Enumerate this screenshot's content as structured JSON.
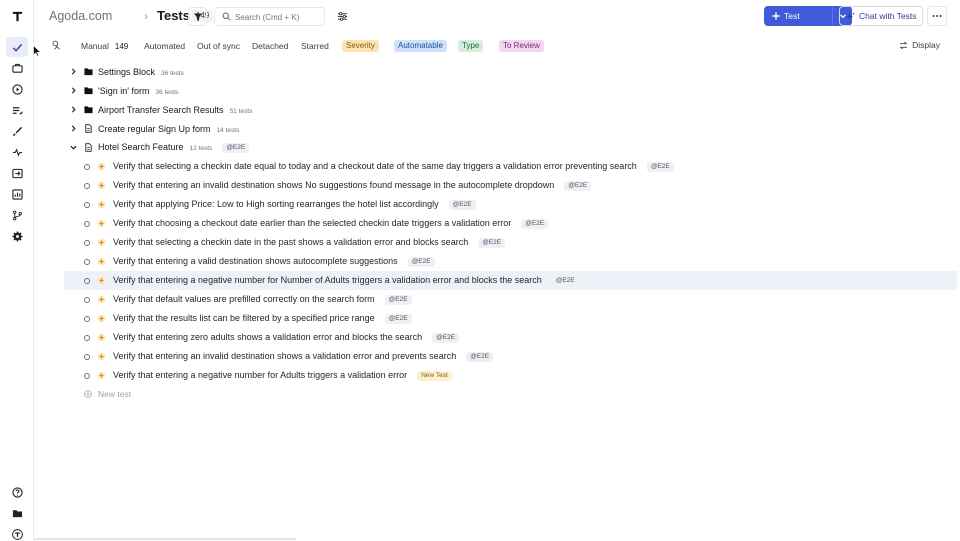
{
  "header": {
    "project": "Agoda.com",
    "separator": "›",
    "title": "Tests",
    "count": "149",
    "search_placeholder": "Search (Cmd + K)",
    "test_button": "Test",
    "chat_button": "Chat with Tests"
  },
  "tabs": {
    "manual": "Manual",
    "manual_count": "149",
    "automated": "Automated",
    "out_of_sync": "Out of sync",
    "detached": "Detached",
    "starred": "Starred",
    "severity": "Severity",
    "automatable": "Automatable",
    "type": "Type",
    "to_review": "To Review",
    "display": "Display"
  },
  "colors": {
    "accent": "#3f5bd8",
    "severity_bg": "#fbe3b4",
    "automatable_bg": "#cfe1fb",
    "type_bg": "#d4f0dc",
    "to_review_bg": "#f1d7f0"
  },
  "folders": [
    {
      "name": "Settings Block",
      "count": "36 tests",
      "icon": "folder-icon",
      "expanded": false
    },
    {
      "name": "'Sign in' form",
      "count": "36 tests",
      "icon": "folder-icon",
      "expanded": false
    },
    {
      "name": "Airport Transfer Search Results",
      "count": "51 tests",
      "icon": "folder-icon",
      "expanded": false
    },
    {
      "name": "Create regular Sign Up form",
      "count": "14 tests",
      "icon": "file-icon",
      "expanded": false
    },
    {
      "name": "Hotel Search Feature",
      "count": "12 tests",
      "icon": "file-icon",
      "expanded": true,
      "tag": "@E2E"
    }
  ],
  "tests": [
    {
      "title": "Verify that selecting a checkin date equal to today and a checkout date of the same day triggers a validation error preventing search",
      "tag": "@E2E"
    },
    {
      "title": "Verify that entering an invalid destination shows No suggestions found message in the autocomplete dropdown",
      "tag": "@E2E"
    },
    {
      "title": "Verify that applying Price: Low to High sorting rearranges the hotel list accordingly",
      "tag": "@E2E"
    },
    {
      "title": "Verify that choosing a checkout date earlier than the selected checkin date triggers a validation error",
      "tag": "@E2E"
    },
    {
      "title": "Verify that selecting a checkin date in the past shows a validation error and blocks search",
      "tag": "@E2E"
    },
    {
      "title": "Verify that entering a valid destination shows autocomplete suggestions",
      "tag": "@E2E"
    },
    {
      "title": "Verify that entering a negative number for Number of Adults triggers a validation error and blocks the search",
      "tag": "@E2E"
    },
    {
      "title": "Verify that default values are prefilled correctly on the search form",
      "tag": "@E2E"
    },
    {
      "title": "Verify that the results list can be filtered by a specified price range",
      "tag": "@E2E"
    },
    {
      "title": "Verify that entering zero adults shows a validation error and blocks the search",
      "tag": "@E2E"
    },
    {
      "title": "Verify that entering an invalid destination shows a validation error and prevents search",
      "tag": "@E2E"
    },
    {
      "title": "Verify that entering a negative number for Adults triggers a validation error",
      "tag": "New Test"
    }
  ],
  "new_test_label": "New test"
}
